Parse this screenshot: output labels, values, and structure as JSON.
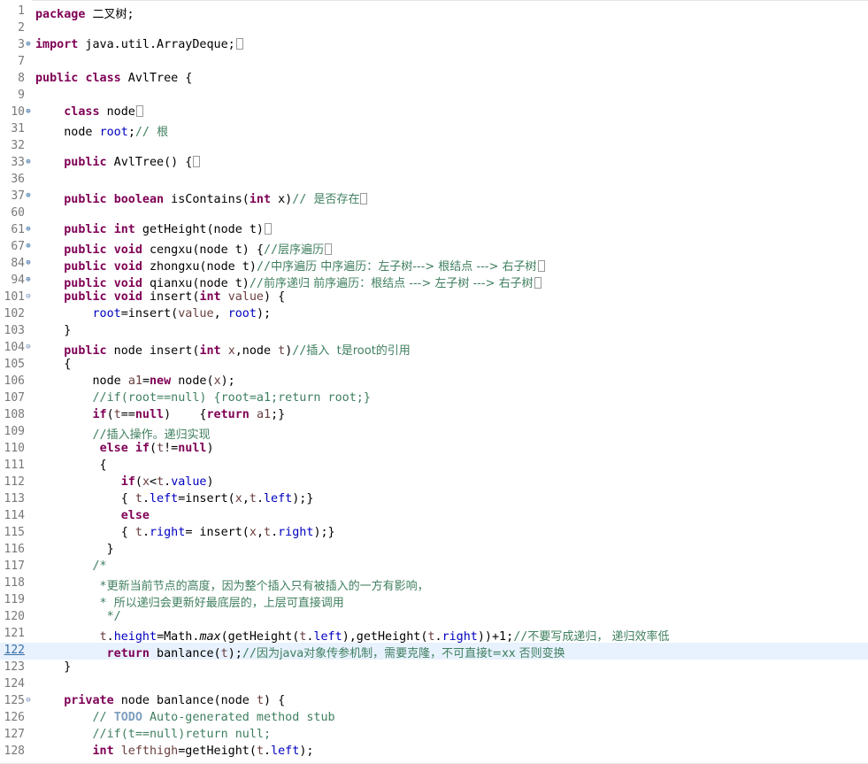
{
  "editor": {
    "lines": [
      {
        "n": "1",
        "fold": "",
        "tokens": [
          [
            "kw",
            "package"
          ],
          [
            "plain",
            " "
          ],
          [
            "cjk",
            "二叉树"
          ],
          [
            "plain",
            ";"
          ]
        ]
      },
      {
        "n": "2",
        "fold": "",
        "tokens": []
      },
      {
        "n": "3",
        "fold": "+",
        "tokens": [
          [
            "kw",
            "import"
          ],
          [
            "plain",
            " java.util.ArrayDeque;"
          ],
          [
            "box",
            ""
          ]
        ]
      },
      {
        "n": "7",
        "fold": "",
        "tokens": []
      },
      {
        "n": "8",
        "fold": "",
        "tokens": [
          [
            "kw",
            "public"
          ],
          [
            "plain",
            " "
          ],
          [
            "kw",
            "class"
          ],
          [
            "plain",
            " AvlTree {"
          ]
        ]
      },
      {
        "n": "9",
        "fold": "",
        "tokens": []
      },
      {
        "n": "10",
        "fold": "+",
        "tokens": [
          [
            "plain",
            "    "
          ],
          [
            "kw",
            "class"
          ],
          [
            "plain",
            " node"
          ],
          [
            "box",
            ""
          ]
        ]
      },
      {
        "n": "31",
        "fold": "",
        "tokens": [
          [
            "plain",
            "    node "
          ],
          [
            "fld",
            "root"
          ],
          [
            "plain",
            ";"
          ],
          [
            "cm",
            "// "
          ],
          [
            "cmcjk",
            "根"
          ]
        ]
      },
      {
        "n": "32",
        "fold": "",
        "tokens": []
      },
      {
        "n": "33",
        "fold": "+",
        "tokens": [
          [
            "plain",
            "    "
          ],
          [
            "kw",
            "public"
          ],
          [
            "plain",
            " AvlTree() {"
          ],
          [
            "box",
            ""
          ]
        ]
      },
      {
        "n": "36",
        "fold": "",
        "tokens": []
      },
      {
        "n": "37",
        "fold": "+",
        "tokens": [
          [
            "plain",
            "    "
          ],
          [
            "kw",
            "public"
          ],
          [
            "plain",
            " "
          ],
          [
            "kw",
            "boolean"
          ],
          [
            "plain",
            " isContains("
          ],
          [
            "kw",
            "int"
          ],
          [
            "plain",
            " x)"
          ],
          [
            "cm",
            "// "
          ],
          [
            "cmcjk",
            "是否存在"
          ],
          [
            "box",
            ""
          ]
        ]
      },
      {
        "n": "60",
        "fold": "",
        "tokens": []
      },
      {
        "n": "61",
        "fold": "+",
        "tokens": [
          [
            "plain",
            "    "
          ],
          [
            "kw",
            "public"
          ],
          [
            "plain",
            " "
          ],
          [
            "kw",
            "int"
          ],
          [
            "plain",
            " getHeight(node t)"
          ],
          [
            "box",
            ""
          ]
        ]
      },
      {
        "n": "67",
        "fold": "+",
        "tokens": [
          [
            "plain",
            "    "
          ],
          [
            "kw",
            "public"
          ],
          [
            "plain",
            " "
          ],
          [
            "kw",
            "void"
          ],
          [
            "plain",
            " cengxu(node t) {"
          ],
          [
            "cm",
            "//"
          ],
          [
            "cmcjk",
            "层序遍历"
          ],
          [
            "box",
            ""
          ]
        ]
      },
      {
        "n": "84",
        "fold": "+",
        "tokens": [
          [
            "plain",
            "    "
          ],
          [
            "kw",
            "public"
          ],
          [
            "plain",
            " "
          ],
          [
            "kw",
            "void"
          ],
          [
            "plain",
            " zhongxu(node t)"
          ],
          [
            "cm",
            "//"
          ],
          [
            "cmcjk",
            "中序遍历 中序遍历：左子树---> 根结点 ---> 右子树"
          ],
          [
            "box",
            ""
          ]
        ]
      },
      {
        "n": "94",
        "fold": "+",
        "tokens": [
          [
            "plain",
            "    "
          ],
          [
            "kw",
            "public"
          ],
          [
            "plain",
            " "
          ],
          [
            "kw",
            "void"
          ],
          [
            "plain",
            " qianxu(node t)"
          ],
          [
            "cm",
            "//"
          ],
          [
            "cmcjk",
            "前序递归 前序遍历：根结点 ---> 左子树 ---> 右子树"
          ],
          [
            "box",
            ""
          ]
        ]
      },
      {
        "n": "101",
        "fold": "-",
        "tokens": [
          [
            "plain",
            "    "
          ],
          [
            "kw",
            "public"
          ],
          [
            "plain",
            " "
          ],
          [
            "kw",
            "void"
          ],
          [
            "plain",
            " insert("
          ],
          [
            "kw",
            "int"
          ],
          [
            "plain",
            " "
          ],
          [
            "var",
            "value"
          ],
          [
            "plain",
            ") {"
          ]
        ]
      },
      {
        "n": "102",
        "fold": "",
        "tokens": [
          [
            "plain",
            "        "
          ],
          [
            "fld",
            "root"
          ],
          [
            "plain",
            "=insert("
          ],
          [
            "var",
            "value"
          ],
          [
            "plain",
            ", "
          ],
          [
            "fld",
            "root"
          ],
          [
            "plain",
            ");"
          ]
        ]
      },
      {
        "n": "103",
        "fold": "",
        "tokens": [
          [
            "plain",
            "    }"
          ]
        ]
      },
      {
        "n": "104",
        "fold": "-",
        "tokens": [
          [
            "plain",
            "    "
          ],
          [
            "kw",
            "public"
          ],
          [
            "plain",
            " node insert("
          ],
          [
            "kw",
            "int"
          ],
          [
            "plain",
            " "
          ],
          [
            "var",
            "x"
          ],
          [
            "plain",
            ",node "
          ],
          [
            "var",
            "t"
          ],
          [
            "plain",
            ")"
          ],
          [
            "cm",
            "//"
          ],
          [
            "cmcjk",
            "插入  t是root的引用"
          ]
        ]
      },
      {
        "n": "105",
        "fold": "",
        "tokens": [
          [
            "plain",
            "    {"
          ]
        ]
      },
      {
        "n": "106",
        "fold": "",
        "tokens": [
          [
            "plain",
            "        node "
          ],
          [
            "var",
            "a1"
          ],
          [
            "plain",
            "="
          ],
          [
            "kw",
            "new"
          ],
          [
            "plain",
            " node("
          ],
          [
            "var",
            "x"
          ],
          [
            "plain",
            ");"
          ]
        ]
      },
      {
        "n": "107",
        "fold": "",
        "tokens": [
          [
            "plain",
            "        "
          ],
          [
            "cm",
            "//if(root==null) {root=a1;return root;}"
          ]
        ]
      },
      {
        "n": "108",
        "fold": "",
        "tokens": [
          [
            "plain",
            "        "
          ],
          [
            "kw",
            "if"
          ],
          [
            "plain",
            "("
          ],
          [
            "var",
            "t"
          ],
          [
            "plain",
            "=="
          ],
          [
            "kw",
            "null"
          ],
          [
            "plain",
            ")    {"
          ],
          [
            "kw",
            "return"
          ],
          [
            "plain",
            " "
          ],
          [
            "var",
            "a1"
          ],
          [
            "plain",
            ";}"
          ]
        ]
      },
      {
        "n": "109",
        "fold": "",
        "tokens": [
          [
            "plain",
            "        "
          ],
          [
            "cm",
            "//"
          ],
          [
            "cmcjk",
            "插入操作。递归实现"
          ]
        ]
      },
      {
        "n": "110",
        "fold": "",
        "tokens": [
          [
            "plain",
            "         "
          ],
          [
            "kw",
            "else"
          ],
          [
            "plain",
            " "
          ],
          [
            "kw",
            "if"
          ],
          [
            "plain",
            "("
          ],
          [
            "var",
            "t"
          ],
          [
            "plain",
            "!="
          ],
          [
            "kw",
            "null"
          ],
          [
            "plain",
            ")"
          ]
        ]
      },
      {
        "n": "111",
        "fold": "",
        "tokens": [
          [
            "plain",
            "         {"
          ]
        ]
      },
      {
        "n": "112",
        "fold": "",
        "tokens": [
          [
            "plain",
            "            "
          ],
          [
            "kw",
            "if"
          ],
          [
            "plain",
            "("
          ],
          [
            "var",
            "x"
          ],
          [
            "plain",
            "<"
          ],
          [
            "var",
            "t"
          ],
          [
            "plain",
            "."
          ],
          [
            "fld",
            "value"
          ],
          [
            "plain",
            ")"
          ]
        ]
      },
      {
        "n": "113",
        "fold": "",
        "tokens": [
          [
            "plain",
            "            { "
          ],
          [
            "var",
            "t"
          ],
          [
            "plain",
            "."
          ],
          [
            "fld",
            "left"
          ],
          [
            "plain",
            "=insert("
          ],
          [
            "var",
            "x"
          ],
          [
            "plain",
            ","
          ],
          [
            "var",
            "t"
          ],
          [
            "plain",
            "."
          ],
          [
            "fld",
            "left"
          ],
          [
            "plain",
            ");}"
          ]
        ]
      },
      {
        "n": "114",
        "fold": "",
        "tokens": [
          [
            "plain",
            "            "
          ],
          [
            "kw",
            "else"
          ]
        ]
      },
      {
        "n": "115",
        "fold": "",
        "tokens": [
          [
            "plain",
            "            { "
          ],
          [
            "var",
            "t"
          ],
          [
            "plain",
            "."
          ],
          [
            "fld",
            "right"
          ],
          [
            "plain",
            "= insert("
          ],
          [
            "var",
            "x"
          ],
          [
            "plain",
            ","
          ],
          [
            "var",
            "t"
          ],
          [
            "plain",
            "."
          ],
          [
            "fld",
            "right"
          ],
          [
            "plain",
            ");}"
          ]
        ]
      },
      {
        "n": "116",
        "fold": "",
        "tokens": [
          [
            "plain",
            "          }"
          ]
        ]
      },
      {
        "n": "117",
        "fold": "",
        "tokens": [
          [
            "plain",
            "        "
          ],
          [
            "cm",
            "/*"
          ]
        ]
      },
      {
        "n": "118",
        "fold": "",
        "tokens": [
          [
            "plain",
            "        "
          ],
          [
            "cm",
            " *"
          ],
          [
            "cmcjk",
            "更新当前节点的高度，因为整个插入只有被插入的一方有影响，"
          ]
        ]
      },
      {
        "n": "119",
        "fold": "",
        "tokens": [
          [
            "plain",
            "        "
          ],
          [
            "cm",
            " * "
          ],
          [
            "cmcjk",
            "所以递归会更新好最底层的，上层可直接调用"
          ]
        ]
      },
      {
        "n": "120",
        "fold": "",
        "tokens": [
          [
            "plain",
            "        "
          ],
          [
            "cm",
            "  */"
          ]
        ]
      },
      {
        "n": "121",
        "fold": "",
        "tokens": [
          [
            "plain",
            "         "
          ],
          [
            "var",
            "t"
          ],
          [
            "plain",
            "."
          ],
          [
            "fld",
            "height"
          ],
          [
            "plain",
            "=Math."
          ],
          [
            "italic",
            "max"
          ],
          [
            "plain",
            "(getHeight("
          ],
          [
            "var",
            "t"
          ],
          [
            "plain",
            "."
          ],
          [
            "fld",
            "left"
          ],
          [
            "plain",
            "),getHeight("
          ],
          [
            "var",
            "t"
          ],
          [
            "plain",
            "."
          ],
          [
            "fld",
            "right"
          ],
          [
            "plain",
            "))+1;"
          ],
          [
            "cm",
            "//"
          ],
          [
            "cmcjk",
            "不要写成递归， 递归效率低"
          ]
        ]
      },
      {
        "n": "122",
        "fold": "",
        "current": true,
        "tokens": [
          [
            "plain",
            "          "
          ],
          [
            "kw",
            "return"
          ],
          [
            "plain",
            " banlance("
          ],
          [
            "var",
            "t"
          ],
          [
            "plain",
            ");"
          ],
          [
            "cm",
            "//"
          ],
          [
            "cmcjk",
            "因为java对象传参机制，需要克隆，不可直接t=xx 否则变换"
          ]
        ]
      },
      {
        "n": "123",
        "fold": "",
        "tokens": [
          [
            "plain",
            "    }"
          ]
        ]
      },
      {
        "n": "124",
        "fold": "",
        "tokens": []
      },
      {
        "n": "125",
        "fold": "-",
        "tokens": [
          [
            "plain",
            "    "
          ],
          [
            "kw",
            "private"
          ],
          [
            "plain",
            " node banlance(node "
          ],
          [
            "var",
            "t"
          ],
          [
            "plain",
            ") {"
          ]
        ]
      },
      {
        "n": "126",
        "fold": "",
        "tokens": [
          [
            "plain",
            "        "
          ],
          [
            "cm",
            "// "
          ],
          [
            "todo",
            "TODO"
          ],
          [
            "cm",
            " Auto-generated method stub"
          ]
        ]
      },
      {
        "n": "127",
        "fold": "",
        "tokens": [
          [
            "plain",
            "        "
          ],
          [
            "cm",
            "//if(t==null)return null;"
          ]
        ]
      },
      {
        "n": "128",
        "fold": "",
        "tokens": [
          [
            "plain",
            "        "
          ],
          [
            "kw",
            "int"
          ],
          [
            "plain",
            " "
          ],
          [
            "var",
            "lefthigh"
          ],
          [
            "plain",
            "=getHeight("
          ],
          [
            "var",
            "t"
          ],
          [
            "plain",
            "."
          ],
          [
            "fld",
            "left"
          ],
          [
            "plain",
            ");"
          ]
        ]
      }
    ]
  }
}
